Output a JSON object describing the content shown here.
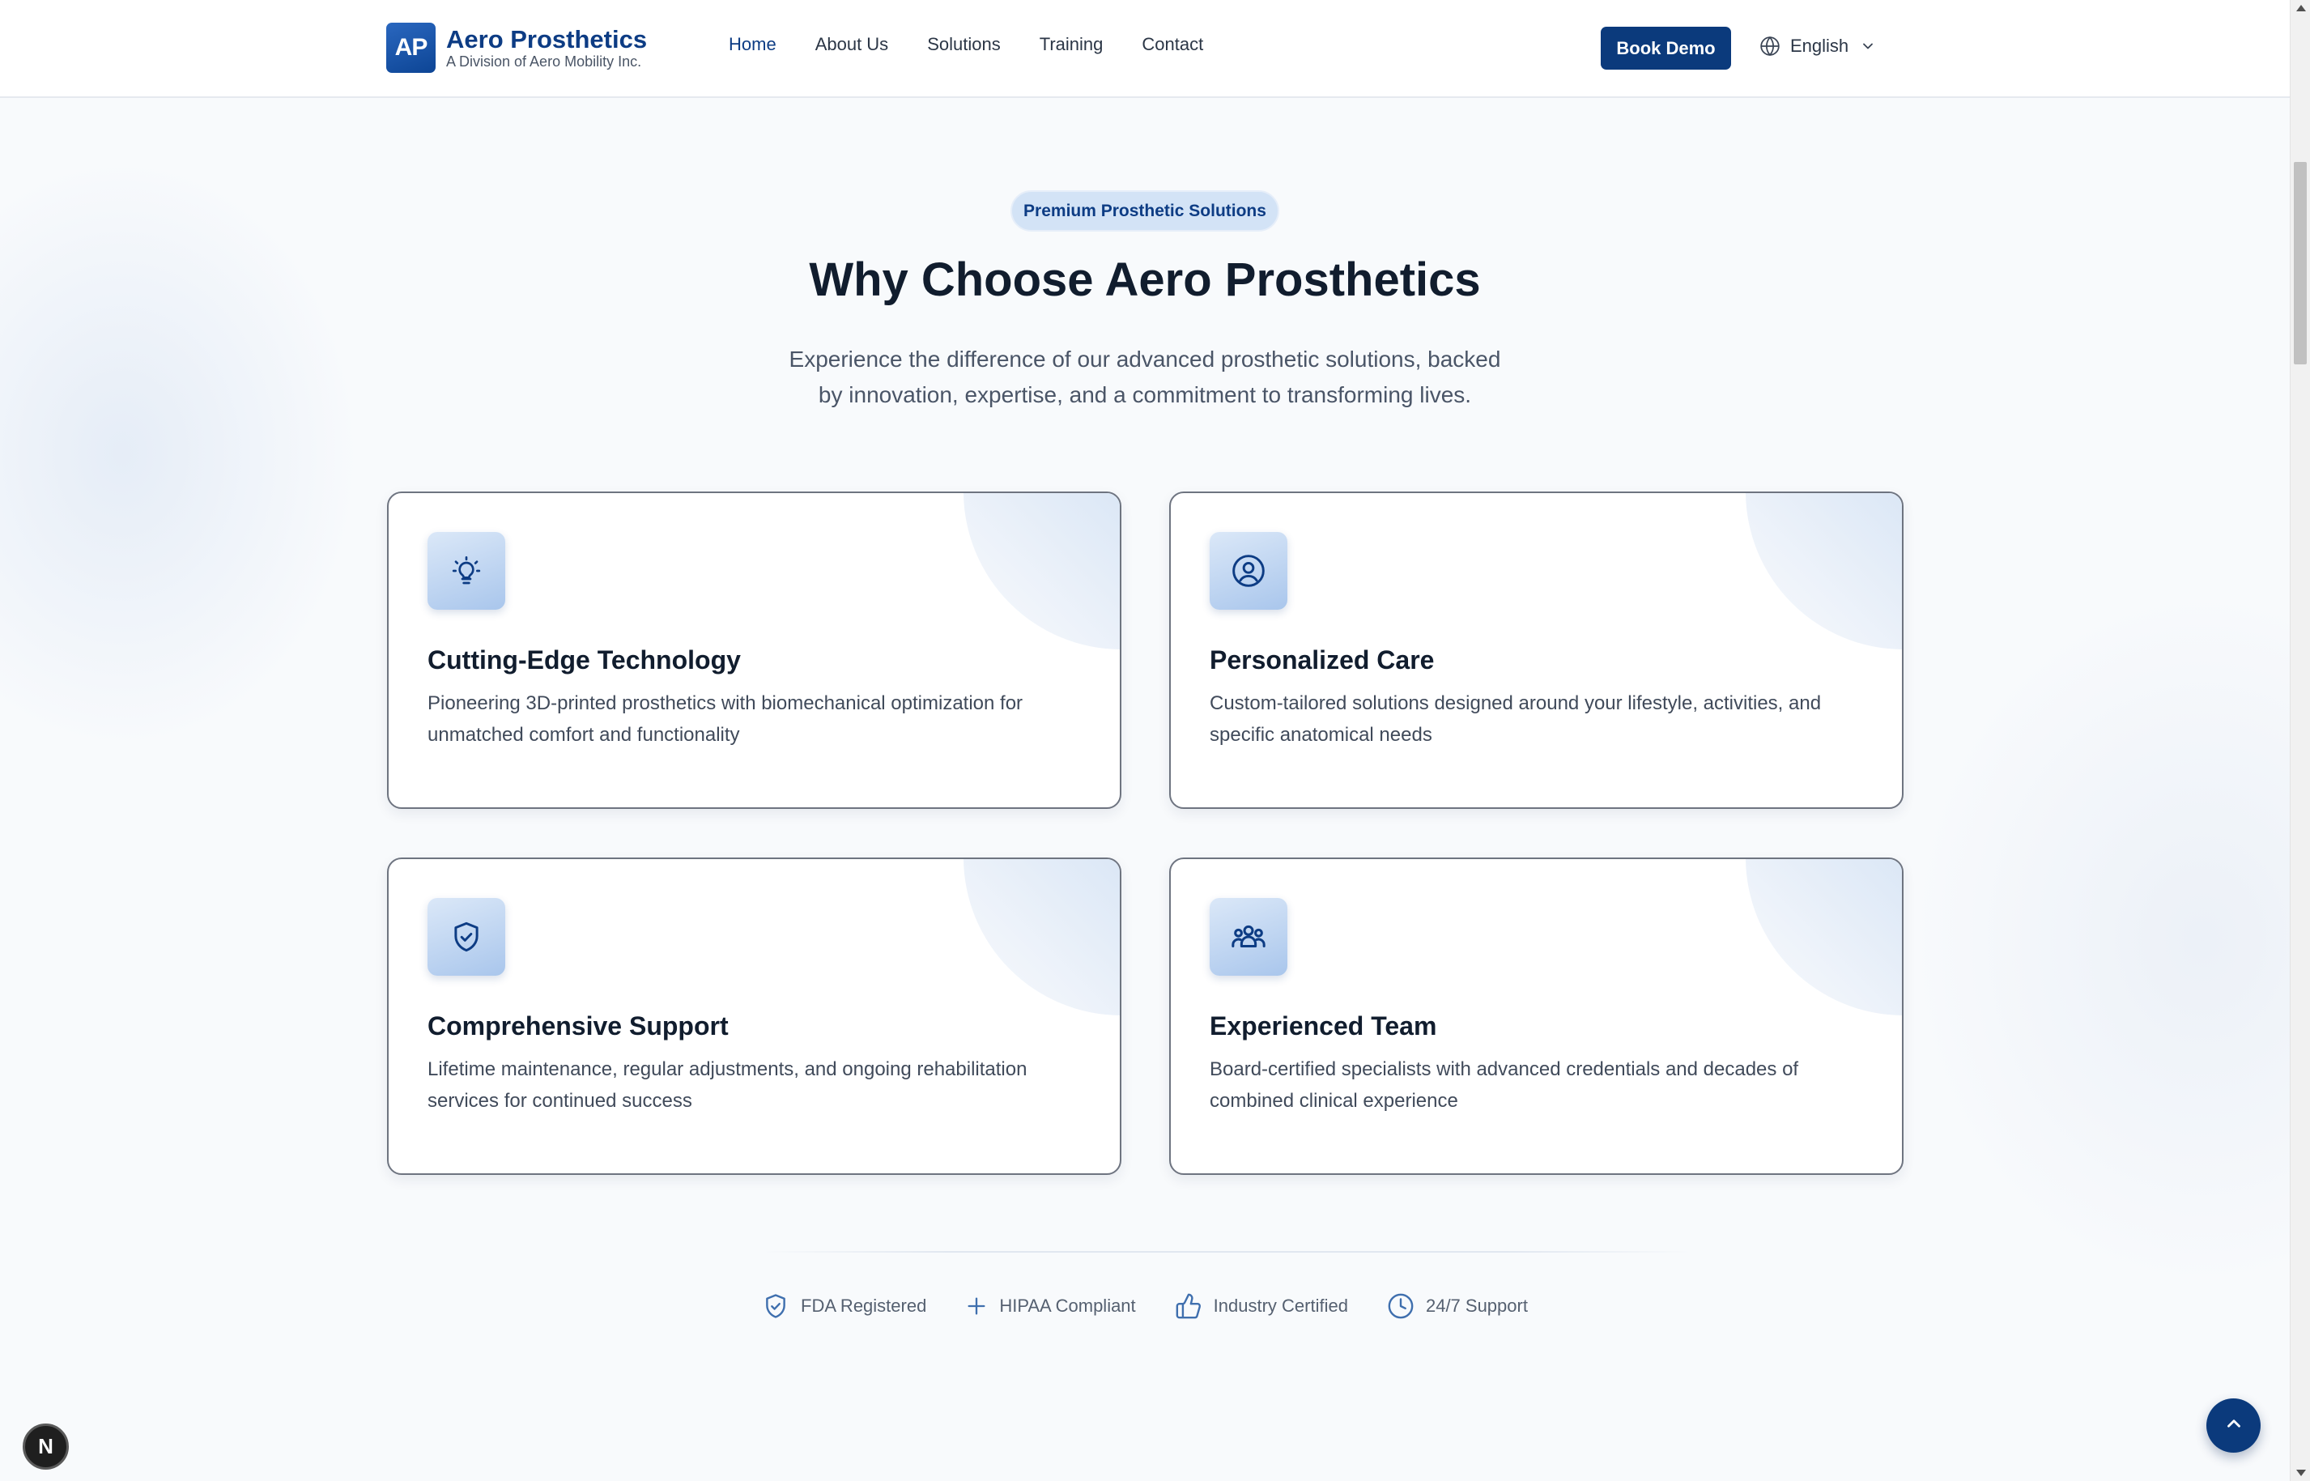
{
  "header": {
    "logo_mark": "AP",
    "brand_name": "Aero Prosthetics",
    "brand_tagline": "A Division of Aero Mobility Inc.",
    "nav": [
      "Home",
      "About Us",
      "Solutions",
      "Training",
      "Contact"
    ],
    "active_nav": "Home",
    "cta_label": "Book Demo",
    "language": "English",
    "icons": {
      "language": "globe-icon",
      "dropdown": "chevron-down-icon"
    }
  },
  "hero": {
    "badge": "Premium Prosthetic Solutions",
    "title": "Why Choose Aero Prosthetics",
    "subtitle": "Experience the difference of our advanced prosthetic solutions, backed by innovation, expertise, and a commitment to transforming lives."
  },
  "features": [
    {
      "icon": "lightbulb-icon",
      "title": "Cutting-Edge Technology",
      "description": "Pioneering 3D-printed prosthetics with biomechanical optimization for unmatched comfort and functionality"
    },
    {
      "icon": "user-circle-icon",
      "title": "Personalized Care",
      "description": "Custom-tailored solutions designed around your lifestyle, activities, and specific anatomical needs"
    },
    {
      "icon": "shield-check-icon",
      "title": "Comprehensive Support",
      "description": "Lifetime maintenance, regular adjustments, and ongoing rehabilitation services for continued success"
    },
    {
      "icon": "team-icon",
      "title": "Experienced Team",
      "description": "Board-certified specialists with advanced credentials and decades of combined clinical experience"
    }
  ],
  "trust_badges": [
    {
      "icon": "shield-check-icon",
      "label": "FDA Registered"
    },
    {
      "icon": "plus-icon",
      "label": "HIPAA Compliant"
    },
    {
      "icon": "thumbs-up-icon",
      "label": "Industry Certified"
    },
    {
      "icon": "clock-icon",
      "label": "24/7 Support"
    }
  ],
  "floating": {
    "dev_badge": "N",
    "back_to_top_icon": "chevron-up-icon"
  },
  "colors": {
    "brand": "#0d3c84",
    "button": "#0b3a7c",
    "pill_bg": "#d3e3f6",
    "card_border": "#6e7480"
  }
}
